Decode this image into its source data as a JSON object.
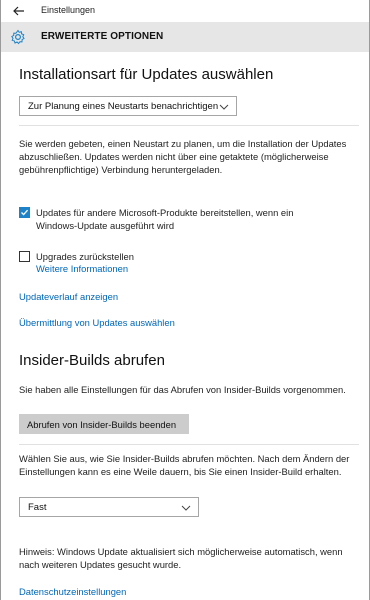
{
  "window": {
    "title": "Einstellungen"
  },
  "header": {
    "title": "ERWEITERTE OPTIONEN"
  },
  "updates": {
    "heading": "Installationsart für Updates auswählen",
    "install_mode": "Zur Planung eines Neustarts benachrichtigen",
    "description": "Sie werden gebeten, einen Neustart zu planen, um die Installation der Updates abzuschließen. Updates werden nicht über eine getaktete (möglicherweise gebührenpflichtige) Verbindung heruntergeladen.",
    "other_products_label": "Updates für andere Microsoft-Produkte bereitstellen, wenn ein Windows-Update ausgeführt wird",
    "other_products_checked": true,
    "defer_label": "Upgrades zurückstellen",
    "defer_checked": false,
    "more_info_link": "Weitere Informationen",
    "history_link": "Updateverlauf anzeigen",
    "delivery_link": "Übermittlung von Updates auswählen"
  },
  "insider": {
    "heading": "Insider-Builds abrufen",
    "status_text": "Sie haben alle Einstellungen für das Abrufen von Insider-Builds vorgenommen.",
    "stop_button": "Abrufen von Insider-Builds beenden",
    "choose_text": "Wählen Sie aus, wie Sie Insider-Builds abrufen möchten. Nach dem Ändern der Einstellungen kann es eine Weile dauern, bis Sie einen Insider-Build erhalten.",
    "ring_value": "Fast"
  },
  "footer": {
    "hint": "Hinweis: Windows Update aktualisiert sich möglicherweise automatisch, wenn nach weiteren Updates gesucht wurde.",
    "privacy_link": "Datenschutzeinstellungen"
  },
  "colors": {
    "accent": "#1e82c8",
    "link": "#0067b8",
    "header_bg": "#e6e6e6",
    "button_bg": "#cccccc"
  }
}
